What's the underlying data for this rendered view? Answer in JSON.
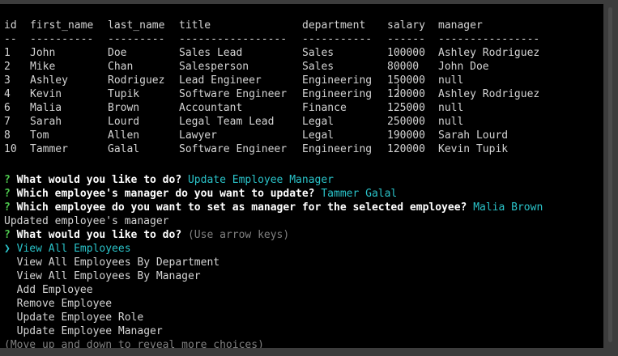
{
  "table": {
    "headers": [
      "id",
      "first_name",
      "last_name",
      "title",
      "department",
      "salary",
      "manager"
    ],
    "separators": [
      "--",
      "----------",
      "---------",
      "-----------------",
      "-----------",
      "------",
      "----------------"
    ],
    "rows": [
      [
        "1",
        "John",
        "Doe",
        "Sales Lead",
        "Sales",
        "100000",
        "Ashley Rodriguez"
      ],
      [
        "2",
        "Mike",
        "Chan",
        "Salesperson",
        "Sales",
        "80000",
        "John Doe"
      ],
      [
        "3",
        "Ashley",
        "Rodriguez",
        "Lead Engineer",
        "Engineering",
        "150000",
        "null"
      ],
      [
        "4",
        "Kevin",
        "Tupik",
        "Software Engineer",
        "Engineering",
        "120000",
        "Ashley Rodriguez"
      ],
      [
        "6",
        "Malia",
        "Brown",
        "Accountant",
        "Finance",
        "125000",
        "null"
      ],
      [
        "7",
        "Sarah",
        "Lourd",
        "Legal Team Lead",
        "Legal",
        "250000",
        "null"
      ],
      [
        "8",
        "Tom",
        "Allen",
        "Lawyer",
        "Legal",
        "190000",
        "Sarah Lourd"
      ],
      [
        "10",
        "Tammer",
        "Galal",
        "Software Engineer",
        "Engineering",
        "120000",
        "Kevin Tupik"
      ]
    ]
  },
  "prompts": {
    "mark": "?",
    "q1": {
      "question": "What would you like to do?",
      "answer": "Update Employee Manager"
    },
    "q2": {
      "question": "Which employee's manager do you want to update?",
      "answer": "Tammer Galal"
    },
    "q3": {
      "question": "Which employee do you want to set as manager for the selected employee?",
      "answer": "Malia Brown"
    },
    "status": "Updated employee's manager",
    "q4": {
      "question": "What would you like to do?",
      "hint": "(Use arrow keys)"
    }
  },
  "menu": {
    "pointer": "❯",
    "selected_index": 0,
    "items": [
      "View All Employees",
      "View All Employees By Department",
      "View All Employees By Manager",
      "Add Employee",
      "Remove Employee",
      "Update Employee Role",
      "Update Employee Manager"
    ],
    "footer": "(Move up and down to reveal more choices)"
  },
  "colors": {
    "background": "#000000",
    "text": "#d4d4d4",
    "question_mark": "#4ec94e",
    "answer": "#2ac3c9",
    "hint": "#808080"
  }
}
